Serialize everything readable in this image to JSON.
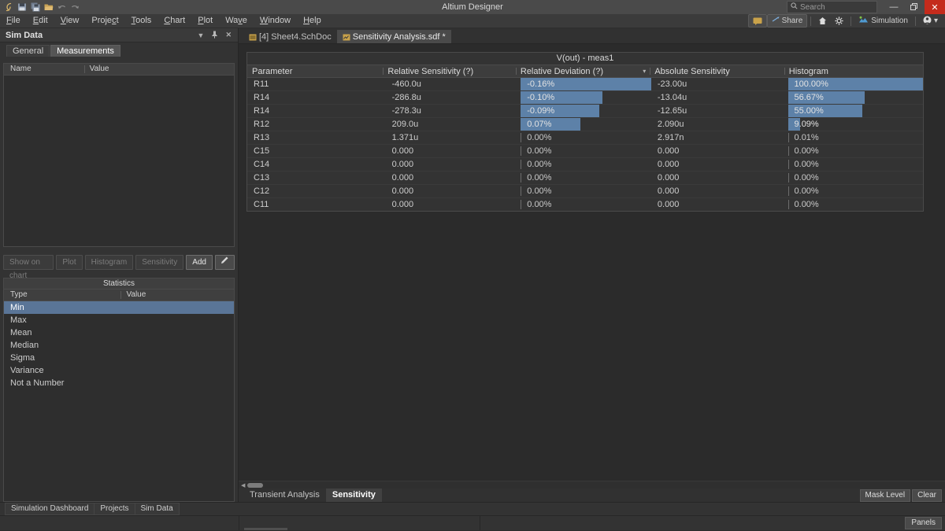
{
  "titlebar": {
    "title": "Altium Designer",
    "toolbar_icons": [
      "altium-logo-icon",
      "save-icon",
      "save-all-icon",
      "open-icon",
      "undo-icon",
      "redo-icon"
    ],
    "search_placeholder": "Search",
    "minimize_label": "—",
    "restore_label": "❐",
    "close_label": "✕"
  },
  "menubar": {
    "items": [
      "File",
      "Edit",
      "View",
      "Project",
      "Tools",
      "Chart",
      "Plot",
      "Wave",
      "Window",
      "Help"
    ],
    "right": {
      "notifications_icon": "message-icon",
      "share_label": "Share",
      "home_icon": "home-icon",
      "settings_icon": "gear-icon",
      "simulation_label": "Simulation",
      "account_icon": "user-icon",
      "account_caret": "▾"
    }
  },
  "sim_data_panel": {
    "title": "Sim Data",
    "controls": [
      "dropdown-caret-icon",
      "pin-icon",
      "close-icon"
    ],
    "tabs": [
      {
        "label": "General",
        "active": false
      },
      {
        "label": "Measurements",
        "active": true
      }
    ],
    "measurements_grid": {
      "columns": [
        "Name",
        "Value"
      ],
      "rows": []
    },
    "buttons": [
      {
        "label": "Show on chart",
        "enabled": false
      },
      {
        "label": "Plot",
        "enabled": false
      },
      {
        "label": "Histogram",
        "enabled": false
      },
      {
        "label": "Sensitivity",
        "enabled": false
      },
      {
        "label": "Add",
        "enabled": true
      },
      {
        "label": "✎",
        "enabled": true,
        "icon": "edit-pencil-icon"
      }
    ],
    "statistics": {
      "title": "Statistics",
      "columns": [
        "Type",
        "Value"
      ],
      "rows": [
        {
          "type": "Min",
          "value": "",
          "selected": true
        },
        {
          "type": "Max",
          "value": "",
          "selected": false
        },
        {
          "type": "Mean",
          "value": "",
          "selected": false
        },
        {
          "type": "Median",
          "value": "",
          "selected": false
        },
        {
          "type": "Sigma",
          "value": "",
          "selected": false
        },
        {
          "type": "Variance",
          "value": "",
          "selected": false
        },
        {
          "type": "Not a Number",
          "value": "",
          "selected": false
        }
      ]
    }
  },
  "document_tabs": [
    {
      "label": "[4] Sheet4.SchDoc",
      "active": false,
      "icon": "schematic-doc-icon"
    },
    {
      "label": "Sensitivity Analysis.sdf *",
      "active": true,
      "icon": "sim-data-file-icon"
    }
  ],
  "sensitivity_table": {
    "group_header": "V(out) - meas1",
    "columns": [
      {
        "label": "Parameter",
        "sorted": false
      },
      {
        "label": "Relative Sensitivity (?)",
        "sorted": false
      },
      {
        "label": "Relative Deviation (?)",
        "sorted": true,
        "caret": "▾"
      },
      {
        "label": "Absolute Sensitivity",
        "sorted": false
      },
      {
        "label": "Histogram",
        "sorted": false
      }
    ],
    "rows": [
      {
        "parameter": "R11",
        "relative_sensitivity": "-460.0u",
        "relative_deviation": "-0.16%",
        "relative_deviation_pct": 100,
        "absolute_sensitivity": "-23.00u",
        "histogram": "100.00%",
        "histogram_pct": 100
      },
      {
        "parameter": "R14",
        "relative_sensitivity": "-286.8u",
        "relative_deviation": "-0.10%",
        "relative_deviation_pct": 62.5,
        "absolute_sensitivity": "-13.04u",
        "histogram": "56.67%",
        "histogram_pct": 56.67
      },
      {
        "parameter": "R14",
        "relative_sensitivity": "-278.3u",
        "relative_deviation": "-0.09%",
        "relative_deviation_pct": 60.5,
        "absolute_sensitivity": "-12.65u",
        "histogram": "55.00%",
        "histogram_pct": 55.0
      },
      {
        "parameter": "R12",
        "relative_sensitivity": "209.0u",
        "relative_deviation": "0.07%",
        "relative_deviation_pct": 45.5,
        "absolute_sensitivity": "2.090u",
        "histogram": "9.09%",
        "histogram_pct": 9.09
      },
      {
        "parameter": "R13",
        "relative_sensitivity": "1.371u",
        "relative_deviation": "0.00%",
        "relative_deviation_pct": 0,
        "absolute_sensitivity": "2.917n",
        "histogram": "0.01%",
        "histogram_pct": 0
      },
      {
        "parameter": "C15",
        "relative_sensitivity": "0.000",
        "relative_deviation": "0.00%",
        "relative_deviation_pct": 0,
        "absolute_sensitivity": "0.000",
        "histogram": "0.00%",
        "histogram_pct": 0
      },
      {
        "parameter": "C14",
        "relative_sensitivity": "0.000",
        "relative_deviation": "0.00%",
        "relative_deviation_pct": 0,
        "absolute_sensitivity": "0.000",
        "histogram": "0.00%",
        "histogram_pct": 0
      },
      {
        "parameter": "C13",
        "relative_sensitivity": "0.000",
        "relative_deviation": "0.00%",
        "relative_deviation_pct": 0,
        "absolute_sensitivity": "0.000",
        "histogram": "0.00%",
        "histogram_pct": 0
      },
      {
        "parameter": "C12",
        "relative_sensitivity": "0.000",
        "relative_deviation": "0.00%",
        "relative_deviation_pct": 0,
        "absolute_sensitivity": "0.000",
        "histogram": "0.00%",
        "histogram_pct": 0
      },
      {
        "parameter": "C11",
        "relative_sensitivity": "0.000",
        "relative_deviation": "0.00%",
        "relative_deviation_pct": 0,
        "absolute_sensitivity": "0.000",
        "histogram": "0.00%",
        "histogram_pct": 0
      }
    ]
  },
  "analysis_tabs": [
    {
      "label": "Transient Analysis",
      "active": false
    },
    {
      "label": "Sensitivity",
      "active": true
    }
  ],
  "analysis_actions": [
    {
      "label": "Mask Level"
    },
    {
      "label": "Clear"
    }
  ],
  "panel_tabs": [
    {
      "label": "Simulation Dashboard"
    },
    {
      "label": "Projects"
    },
    {
      "label": "Sim Data"
    }
  ],
  "statusbar": {
    "panels_label": "Panels"
  },
  "colors": {
    "accent_bar": "#5d81a8",
    "selection": "#5a7597",
    "close_red": "#c42b1c",
    "panel_bg": "#333333",
    "editor_bg": "#2b2b2b",
    "titlebar_bg": "#4a4a4a"
  }
}
